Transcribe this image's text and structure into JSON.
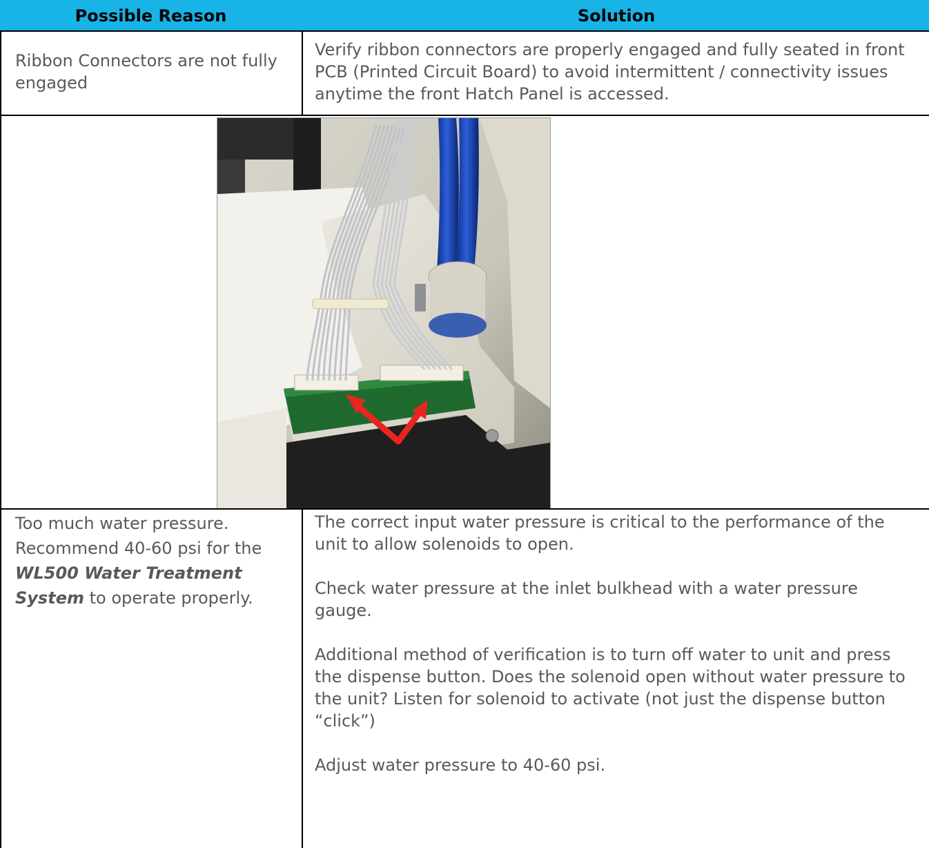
{
  "header": {
    "col1": "Possible Reason",
    "col2": "Solution"
  },
  "rows": [
    {
      "reason": "Ribbon Connectors are not fully engaged",
      "solution": "Verify ribbon connectors are properly engaged and fully seated in front PCB (Printed Circuit Board) to avoid intermittent / connectivity issues anytime the front Hatch Panel is accessed."
    },
    {
      "reason_part1": "Too much water pressure. Recommend 40-60 psi for the ",
      "reason_emphasis": "WL500 Water Treatment System",
      "reason_part2": " to operate properly.",
      "solution_paragraphs": [
        "The correct input water pressure is critical to the performance of the unit to allow solenoids to open.",
        "Check water pressure at the inlet bulkhead with a water pressure gauge.",
        "Additional method of verification is to turn off water to unit and press the dispense button.  Does the solenoid open without water pressure to the unit?  Listen for solenoid to activate (not just the dispense button “click”)",
        "Adjust water pressure to 40-60 psi."
      ]
    }
  ],
  "colors": {
    "header_bg": "#18b4e8",
    "body_text": "#595959",
    "arrow": "#e8261f"
  }
}
